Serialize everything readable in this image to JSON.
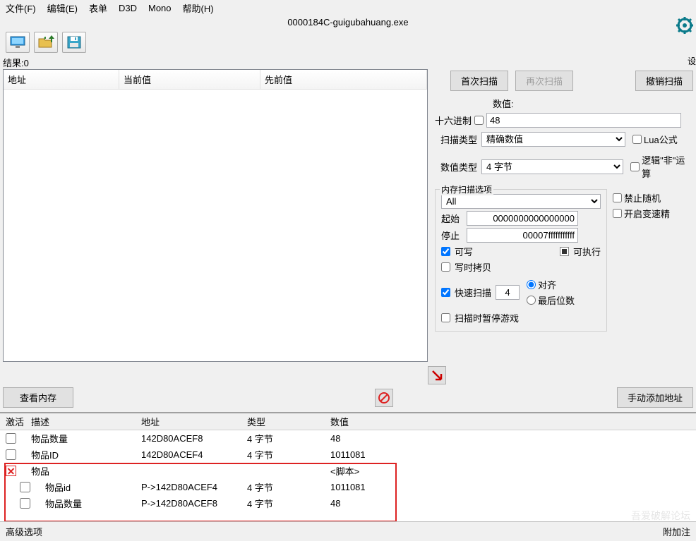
{
  "menu": {
    "file": "文件(F)",
    "edit": "编辑(E)",
    "table": "表单",
    "d3d": "D3D",
    "mono": "Mono",
    "help": "帮助(H)"
  },
  "title": "0000184C-guigubahuang.exe",
  "settings_label": "设",
  "results_label": "结果:0",
  "scan_list": {
    "col_addr": "地址",
    "col_current": "当前值",
    "col_prev": "先前值"
  },
  "buttons": {
    "first_scan": "首次扫描",
    "next_scan": "再次扫描",
    "undo_scan": "撤销扫描",
    "view_mem": "查看内存",
    "manual_add": "手动添加地址"
  },
  "labels": {
    "value": "数值:",
    "hex": "十六进制",
    "scan_type": "扫描类型",
    "value_type": "数值类型",
    "lua": "Lua公式",
    "logic_not": "逻辑\"非\"运算",
    "mem_options": "内存扫描选项",
    "no_random": "禁止随机",
    "enable_speed": "开启变速精",
    "start": "起始",
    "stop": "停止",
    "writable": "可写",
    "executable": "可执行",
    "cow": "写时拷贝",
    "fast_scan": "快速扫描",
    "aligned": "对齐",
    "last_digits": "最后位数",
    "pause": "扫描时暂停游戏"
  },
  "values": {
    "value_input": "48",
    "scan_type": "精确数值",
    "value_type": "4 字节",
    "mem_region": "All",
    "start_addr": "0000000000000000",
    "stop_addr": "00007fffffffffff",
    "fast_align": "4"
  },
  "checks": {
    "hex": false,
    "lua": false,
    "logic_not": false,
    "no_random": false,
    "enable_speed": false,
    "writable": true,
    "executable": "indeterminate",
    "cow": false,
    "fast_scan": true,
    "aligned": true,
    "last_digits": false,
    "pause": false
  },
  "addr_table": {
    "headers": {
      "active": "激活",
      "desc": "描述",
      "addr": "地址",
      "type": "类型",
      "value": "数值"
    },
    "rows": [
      {
        "active": false,
        "desc": "物品数量",
        "addr": "142D80ACEF8",
        "type": "4 字节",
        "value": "48",
        "indent": 0
      },
      {
        "active": false,
        "desc": "物品ID",
        "addr": "142D80ACEF4",
        "type": "4 字节",
        "value": "1011081",
        "indent": 0
      },
      {
        "active": "x",
        "desc": "物品",
        "addr": "",
        "type": "",
        "value": "<脚本>",
        "indent": 0
      },
      {
        "active": false,
        "desc": "物品id",
        "addr": "P->142D80ACEF4",
        "type": "4 字节",
        "value": "1011081",
        "indent": 1
      },
      {
        "active": false,
        "desc": "物品数量",
        "addr": "P->142D80ACEF8",
        "type": "4 字节",
        "value": "48",
        "indent": 1
      }
    ]
  },
  "footer": {
    "adv": "高级选项",
    "attach": "附加注"
  },
  "watermark": "吾爱破解论坛"
}
